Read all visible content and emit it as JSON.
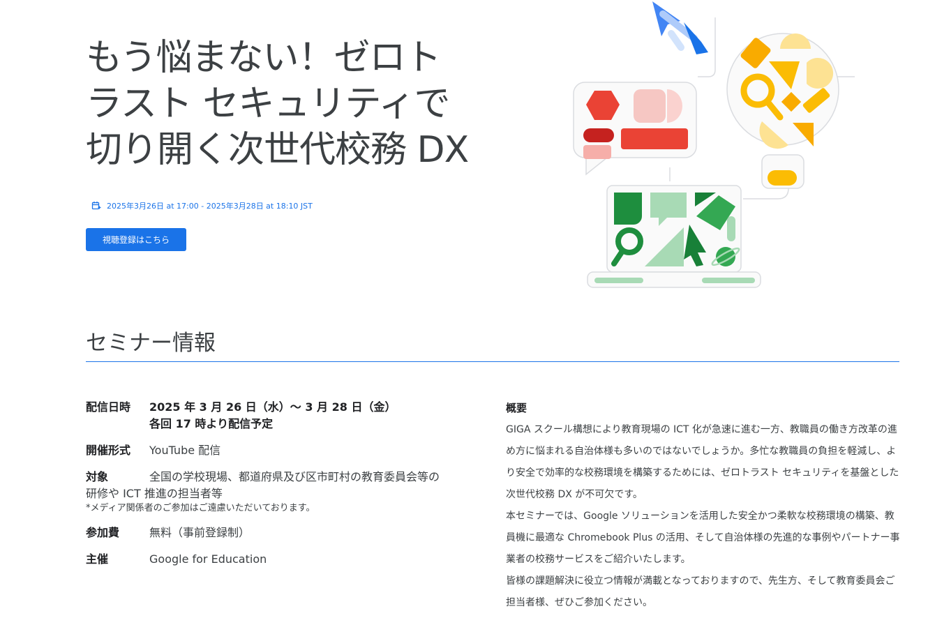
{
  "hero": {
    "title_line1": "もう悩まない！ゼロト",
    "title_line2": "ラスト セキュリティで",
    "title_line3": "切り開く次世代校務 DX",
    "date_range": "2025年3月26日 at 17:00 - 2025年3月28日 at 18:10 JST",
    "cta_label": "視聴登録はこちら"
  },
  "seminar": {
    "title": "セミナー情報",
    "delivery_date": {
      "label": "配信日時",
      "value_line1": "2025 年 3 月 26 日（水）～ 3 月 28 日（金）",
      "value_line2": "各回 17 時より配信予定"
    },
    "format": {
      "label": "開催形式",
      "value": "YouTube 配信"
    },
    "target": {
      "label": "対象",
      "value_line1": "全国の学校現場、都道府県及び区市町村の教育委員会等の",
      "value_line2": "研修や ICT 推進の担当者等",
      "note": "*メディア関係者のご参加はご遠慮いただいております。"
    },
    "fee": {
      "label": "参加費",
      "value": "無料（事前登録制）"
    },
    "organizer": {
      "label": "主催",
      "value": "Google for Education"
    },
    "overview": {
      "heading": "概要",
      "para1": "GIGA スクール構想により教育現場の ICT 化が急速に進む一方、教職員の働き方改革の進め方に悩まれる自治体様も多いのではないでしょうか。多忙な教職員の負担を軽減し、より安全で効率的な校務環境を構築するためには、ゼロトラスト セキュリティを基盤とした次世代校務 DX が不可欠です。",
      "para2": "本セミナーでは、Google ソリューションを活用した安全かつ柔軟な校務環境の構築、教員機に最適な Chromebook Plus の活用、そして自治体様の先進的な事例やパートナー事業者の校務サービスをご紹介いたします。",
      "para3": "皆様の課題解決に役立つ情報が満載となっておりますので、先生方、そして教育委員会ご担当者様、ぜひご参加ください。"
    }
  },
  "colors": {
    "accent": "#1a73e8",
    "red": "#ea4335",
    "yellow": "#fbbc04",
    "green": "#34a853"
  }
}
